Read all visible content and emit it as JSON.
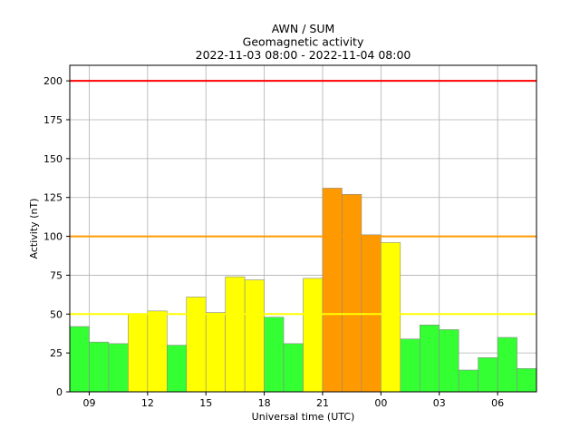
{
  "chart_data": {
    "type": "bar",
    "title": [
      "AWN / SUM",
      "Geomagnetic activity",
      "2022-11-03 08:00 - 2022-11-04 08:00"
    ],
    "xlabel": "Universal time (UTC)",
    "ylabel": "Activity (nT)",
    "ylim": [
      0,
      210
    ],
    "yticks": [
      0,
      25,
      50,
      75,
      100,
      125,
      150,
      175,
      200
    ],
    "xlim": [
      8,
      32
    ],
    "xticks": [
      {
        "x": 9,
        "label": "09"
      },
      {
        "x": 12,
        "label": "12"
      },
      {
        "x": 15,
        "label": "15"
      },
      {
        "x": 18,
        "label": "18"
      },
      {
        "x": 21,
        "label": "21"
      },
      {
        "x": 24,
        "label": "00"
      },
      {
        "x": 27,
        "label": "03"
      },
      {
        "x": 30,
        "label": "06"
      }
    ],
    "grid": true,
    "bar_width_hours": 1,
    "x_start_hours": [
      8,
      9,
      10,
      11,
      12,
      13,
      14,
      15,
      16,
      17,
      18,
      19,
      20,
      21,
      22,
      23,
      24,
      25,
      26,
      27,
      28,
      29,
      30,
      31
    ],
    "values": [
      42,
      32,
      31,
      50,
      52,
      30,
      61,
      51,
      74,
      72,
      48,
      31,
      73,
      131,
      127,
      101,
      96,
      34,
      43,
      40,
      14,
      22,
      35,
      15
    ],
    "thresholds": [
      {
        "value": 50,
        "color": "#ffff00"
      },
      {
        "value": 100,
        "color": "#ff9900"
      },
      {
        "value": 200,
        "color": "#ff0000"
      }
    ],
    "level_colors": {
      "low": "#33ff33",
      "moderate": "#ffff00",
      "high": "#ff9900",
      "severe": "#ff0000"
    }
  }
}
